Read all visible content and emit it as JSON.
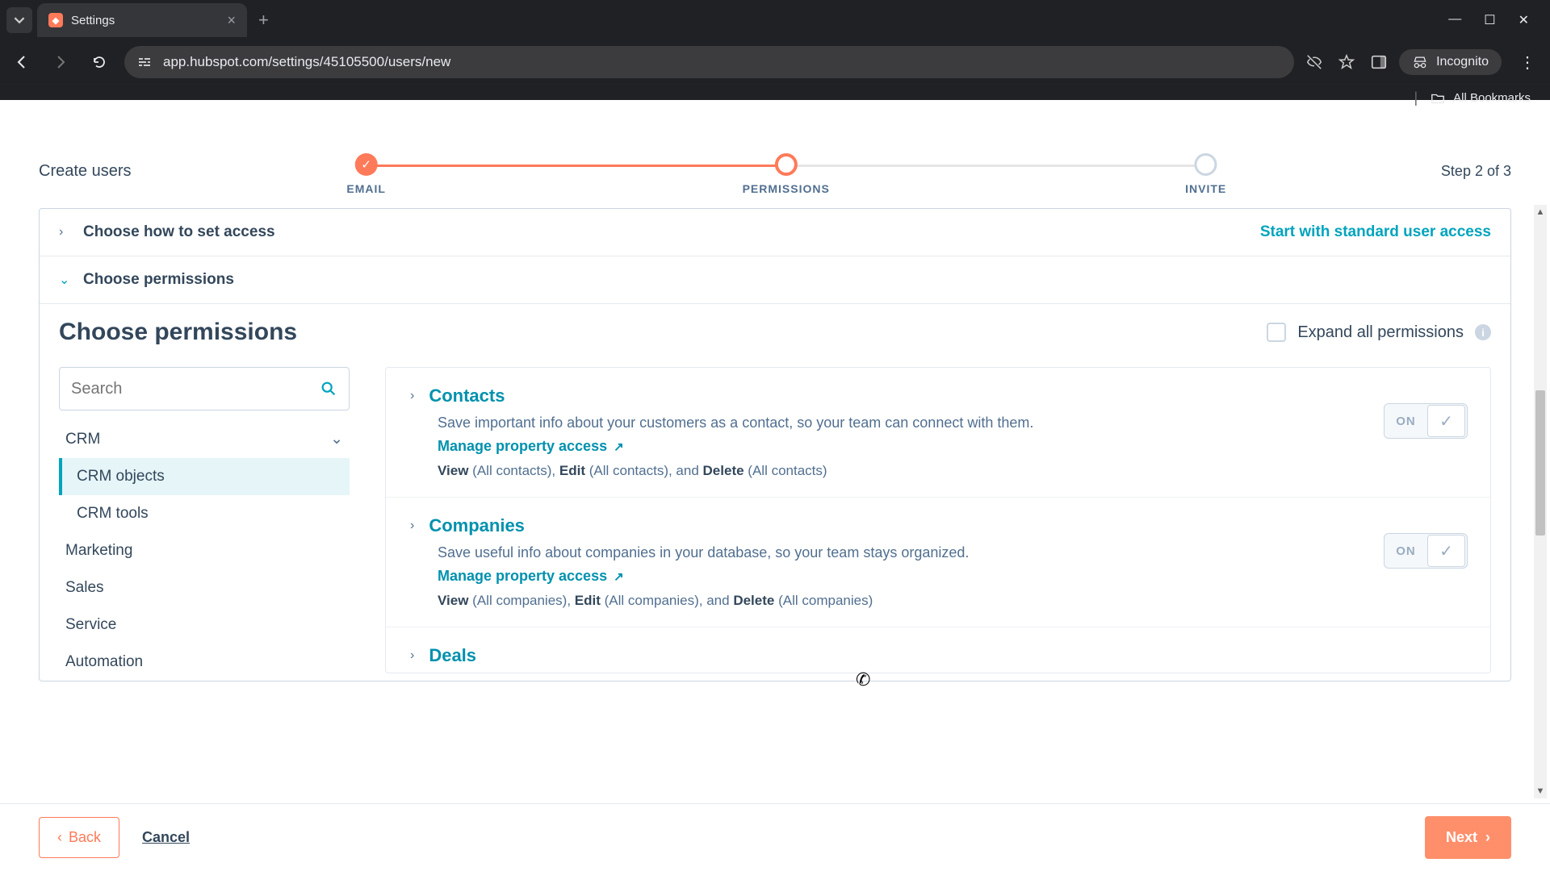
{
  "browser": {
    "tab_title": "Settings",
    "url": "app.hubspot.com/settings/45105500/users/new",
    "incognito_label": "Incognito",
    "bookmarks_label": "All Bookmarks"
  },
  "header": {
    "page_title": "Create users",
    "step_indicator": "Step 2 of 3",
    "steps": {
      "email": "EMAIL",
      "permissions": "PERMISSIONS",
      "invite": "INVITE"
    }
  },
  "accordion": {
    "access_title": "Choose how to set access",
    "access_hint": "Start with standard user access",
    "permissions_title": "Choose permissions"
  },
  "permissions": {
    "heading": "Choose permissions",
    "expand_label": "Expand all permissions",
    "search_placeholder": "Search",
    "categories": {
      "crm": "CRM",
      "crm_objects": "CRM objects",
      "crm_tools": "CRM tools",
      "marketing": "Marketing",
      "sales": "Sales",
      "service": "Service",
      "automation": "Automation"
    },
    "toggle_on": "ON",
    "manage_link": "Manage property access",
    "items": {
      "contacts": {
        "title": "Contacts",
        "desc": "Save important info about your customers as a contact, so your team can connect with them.",
        "view_lbl": "View",
        "view_scope": "(All contacts),",
        "edit_lbl": "Edit",
        "edit_scope": "(All contacts), and",
        "del_lbl": "Delete",
        "del_scope": "(All contacts)"
      },
      "companies": {
        "title": "Companies",
        "desc": "Save useful info about companies in your database, so your team stays organized.",
        "view_lbl": "View",
        "view_scope": "(All companies),",
        "edit_lbl": "Edit",
        "edit_scope": "(All companies), and",
        "del_lbl": "Delete",
        "del_scope": "(All companies)"
      },
      "deals": {
        "title": "Deals"
      }
    }
  },
  "footer": {
    "back": "Back",
    "cancel": "Cancel",
    "next": "Next"
  }
}
